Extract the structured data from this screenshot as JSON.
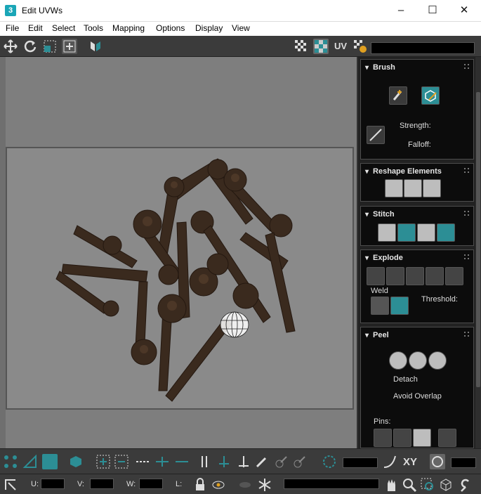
{
  "window": {
    "app_icon": "3",
    "title": "Edit UVWs",
    "minimize": "–",
    "maximize": "☐",
    "close": "✕"
  },
  "menu": [
    "File",
    "Edit",
    "Select",
    "Tools",
    "Mapping",
    "Options",
    "Display",
    "View"
  ],
  "toolbar": {
    "uv_label": "UV"
  },
  "panel": {
    "brush": {
      "title": "Brush",
      "strength": "Strength:",
      "falloff": "Falloff:"
    },
    "reshape": {
      "title": "Reshape Elements"
    },
    "stitch": {
      "title": "Stitch"
    },
    "explode": {
      "title": "Explode",
      "weld": "Weld",
      "threshold": "Threshold:"
    },
    "peel": {
      "title": "Peel",
      "detach": "Detach",
      "avoid_overlap": "Avoid Overlap",
      "pins": "Pins:"
    }
  },
  "bottom": {
    "xy": "XY",
    "u": "U:",
    "v": "V:",
    "w": "W:",
    "l": "L:"
  },
  "colors": {
    "accent": "#2c8e95",
    "panel_bg": "#0c0c0c",
    "toolbar_bg": "#3b3b3b",
    "viewport_bg": "#7e7e7e"
  }
}
